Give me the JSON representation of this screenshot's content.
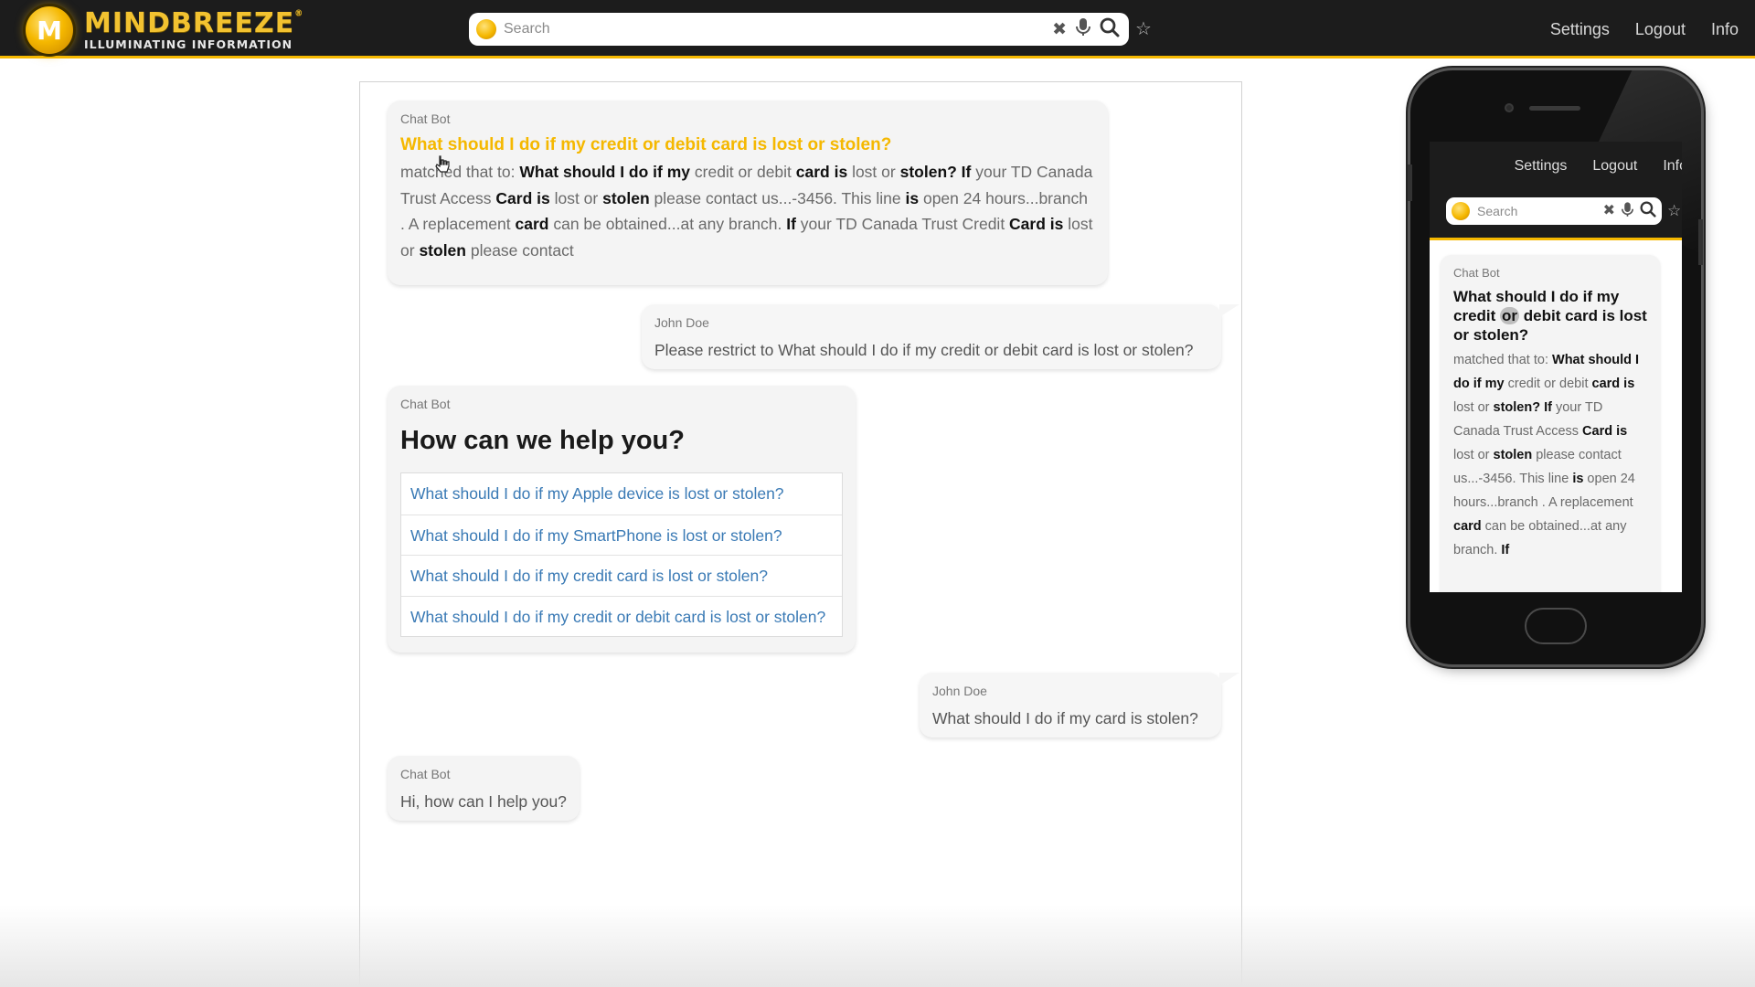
{
  "header": {
    "logo_badge": "M",
    "logo_name": "MINDBREEZE",
    "logo_trademark": "®",
    "logo_tagline": "ILLUMINATING INFORMATION",
    "search_placeholder": "Search",
    "icons": [
      "clear-icon",
      "microphone-icon",
      "search-icon",
      "star-icon"
    ],
    "nav": [
      "Settings",
      "Logout",
      "Info"
    ],
    "accent_color": "#f5b800"
  },
  "chat": {
    "messages": [
      {
        "sender": "Chat Bot",
        "type": "result",
        "title": "What should I do if my credit or debit card is lost or stolen?",
        "snippet": [
          {
            "t": "matched that to: ",
            "b": false
          },
          {
            "t": "What should I do if my",
            "b": true
          },
          {
            "t": " credit or debit ",
            "b": false
          },
          {
            "t": "card is",
            "b": true
          },
          {
            "t": " lost or ",
            "b": false
          },
          {
            "t": "stolen? If",
            "b": true
          },
          {
            "t": " your TD Canada Trust Access ",
            "b": false
          },
          {
            "t": "Card is",
            "b": true
          },
          {
            "t": " lost or ",
            "b": false
          },
          {
            "t": "stolen",
            "b": true
          },
          {
            "t": " please contact us...-3456. This line ",
            "b": false
          },
          {
            "t": "is",
            "b": true
          },
          {
            "t": " open 24 hours...branch . A replacement ",
            "b": false
          },
          {
            "t": "card",
            "b": true
          },
          {
            "t": " can be obtained...at any branch. ",
            "b": false
          },
          {
            "t": "If",
            "b": true
          },
          {
            "t": " your TD Canada Trust Credit ",
            "b": false
          },
          {
            "t": "Card is",
            "b": true
          },
          {
            "t": " lost or ",
            "b": false
          },
          {
            "t": "stolen",
            "b": true
          },
          {
            "t": " please contact",
            "b": false
          }
        ]
      },
      {
        "sender": "John Doe",
        "type": "user",
        "text": "Please restrict to What should I do if my credit or debit card is lost or stolen?"
      },
      {
        "sender": "Chat Bot",
        "type": "options",
        "heading": "How can we help you?",
        "options": [
          "What should I do if my Apple device is lost or stolen?",
          "What should I do if my SmartPhone is lost or stolen?",
          "What should I do if my credit card is lost or stolen?",
          "What should I do if my credit or debit card is lost or stolen?"
        ]
      },
      {
        "sender": "John Doe",
        "type": "user",
        "text": "What should I do if my card is stolen?"
      },
      {
        "sender": "Chat Bot",
        "type": "text",
        "text": "Hi, how can I help you?"
      }
    ]
  },
  "phone": {
    "nav": [
      "Settings",
      "Logout",
      "Info"
    ],
    "search_placeholder": "Search",
    "message": {
      "sender": "Chat Bot",
      "title_before": "What should I do if my credit ",
      "title_highlight": "or",
      "title_after": " debit card is lost or stolen?",
      "snippet": [
        {
          "t": "matched that to: ",
          "b": false
        },
        {
          "t": "What should I do if my",
          "b": true
        },
        {
          "t": " credit or debit ",
          "b": false
        },
        {
          "t": "card is",
          "b": true
        },
        {
          "t": " lost or ",
          "b": false
        },
        {
          "t": "stolen? If",
          "b": true
        },
        {
          "t": " your TD Canada Trust Access ",
          "b": false
        },
        {
          "t": "Card is",
          "b": true
        },
        {
          "t": " lost or ",
          "b": false
        },
        {
          "t": "stolen",
          "b": true
        },
        {
          "t": " please contact us...-3456. This line ",
          "b": false
        },
        {
          "t": "is",
          "b": true
        },
        {
          "t": " open 24 hours...branch . A replacement ",
          "b": false
        },
        {
          "t": "card",
          "b": true
        },
        {
          "t": " can be obtained...at any branch. ",
          "b": false
        },
        {
          "t": "If",
          "b": true
        }
      ]
    }
  }
}
